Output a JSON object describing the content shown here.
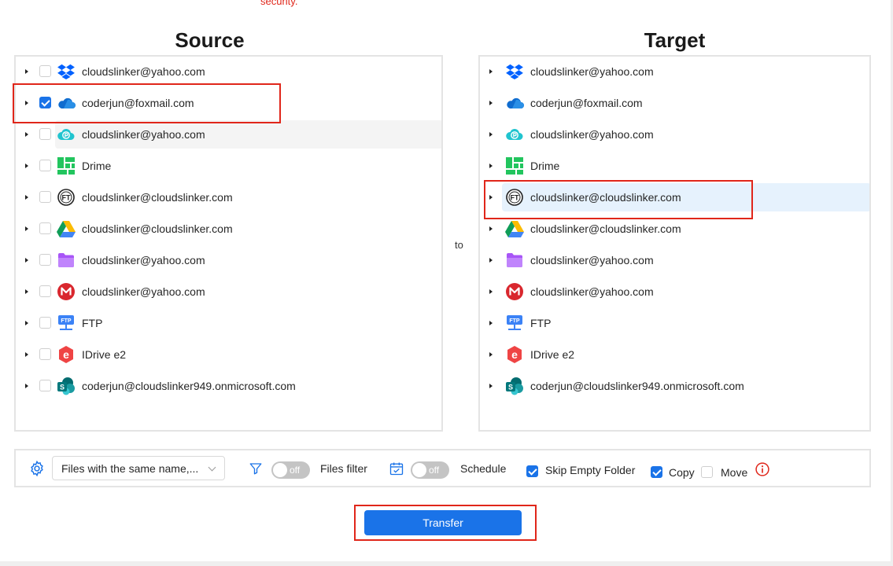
{
  "top_note": "security.",
  "source": {
    "title": "Source",
    "items": [
      {
        "label": "cloudslinker@yahoo.com",
        "icon": "dropbox-icon",
        "checked": false
      },
      {
        "label": "coderjun@foxmail.com",
        "icon": "onedrive-icon",
        "checked": true
      },
      {
        "label": "cloudslinker@yahoo.com",
        "icon": "pcloud-icon",
        "checked": false
      },
      {
        "label": "Drime",
        "icon": "drime-icon",
        "checked": false
      },
      {
        "label": "cloudslinker@cloudslinker.com",
        "icon": "ftp-server-icon",
        "checked": false
      },
      {
        "label": "cloudslinker@cloudslinker.com",
        "icon": "google-drive-icon",
        "checked": false
      },
      {
        "label": "cloudslinker@yahoo.com",
        "icon": "purple-folder-icon",
        "checked": false
      },
      {
        "label": "cloudslinker@yahoo.com",
        "icon": "mega-icon",
        "checked": false
      },
      {
        "label": "FTP",
        "icon": "ftp-icon",
        "checked": false
      },
      {
        "label": "IDrive e2",
        "icon": "idrive-e2-icon",
        "checked": false
      },
      {
        "label": "coderjun@cloudslinker949.onmicrosoft.com",
        "icon": "sharepoint-icon",
        "checked": false
      }
    ]
  },
  "to_label": "to",
  "target": {
    "title": "Target",
    "items": [
      {
        "label": "cloudslinker@yahoo.com",
        "icon": "dropbox-icon"
      },
      {
        "label": "coderjun@foxmail.com",
        "icon": "onedrive-icon"
      },
      {
        "label": "cloudslinker@yahoo.com",
        "icon": "pcloud-icon"
      },
      {
        "label": "Drime",
        "icon": "drime-icon"
      },
      {
        "label": "cloudslinker@cloudslinker.com",
        "icon": "ftp-server-icon",
        "selected": true
      },
      {
        "label": "cloudslinker@cloudslinker.com",
        "icon": "google-drive-icon"
      },
      {
        "label": "cloudslinker@yahoo.com",
        "icon": "purple-folder-icon"
      },
      {
        "label": "cloudslinker@yahoo.com",
        "icon": "mega-icon"
      },
      {
        "label": "FTP",
        "icon": "ftp-icon"
      },
      {
        "label": "IDrive e2",
        "icon": "idrive-e2-icon"
      },
      {
        "label": "coderjun@cloudslinker949.onmicrosoft.com",
        "icon": "sharepoint-icon"
      }
    ]
  },
  "toolbar": {
    "conflict_select": "Files with the same name,...",
    "files_filter_toggle": "off",
    "files_filter_label": "Files filter",
    "schedule_toggle": "off",
    "schedule_label": "Schedule",
    "skip_empty_label": "Skip Empty Folder",
    "skip_empty_checked": true,
    "copy_label": "Copy",
    "copy_checked": true,
    "move_label": "Move",
    "move_checked": false
  },
  "transfer_label": "Transfer",
  "colors": {
    "accent": "#1a73e8",
    "highlight_red": "#e0261a"
  }
}
